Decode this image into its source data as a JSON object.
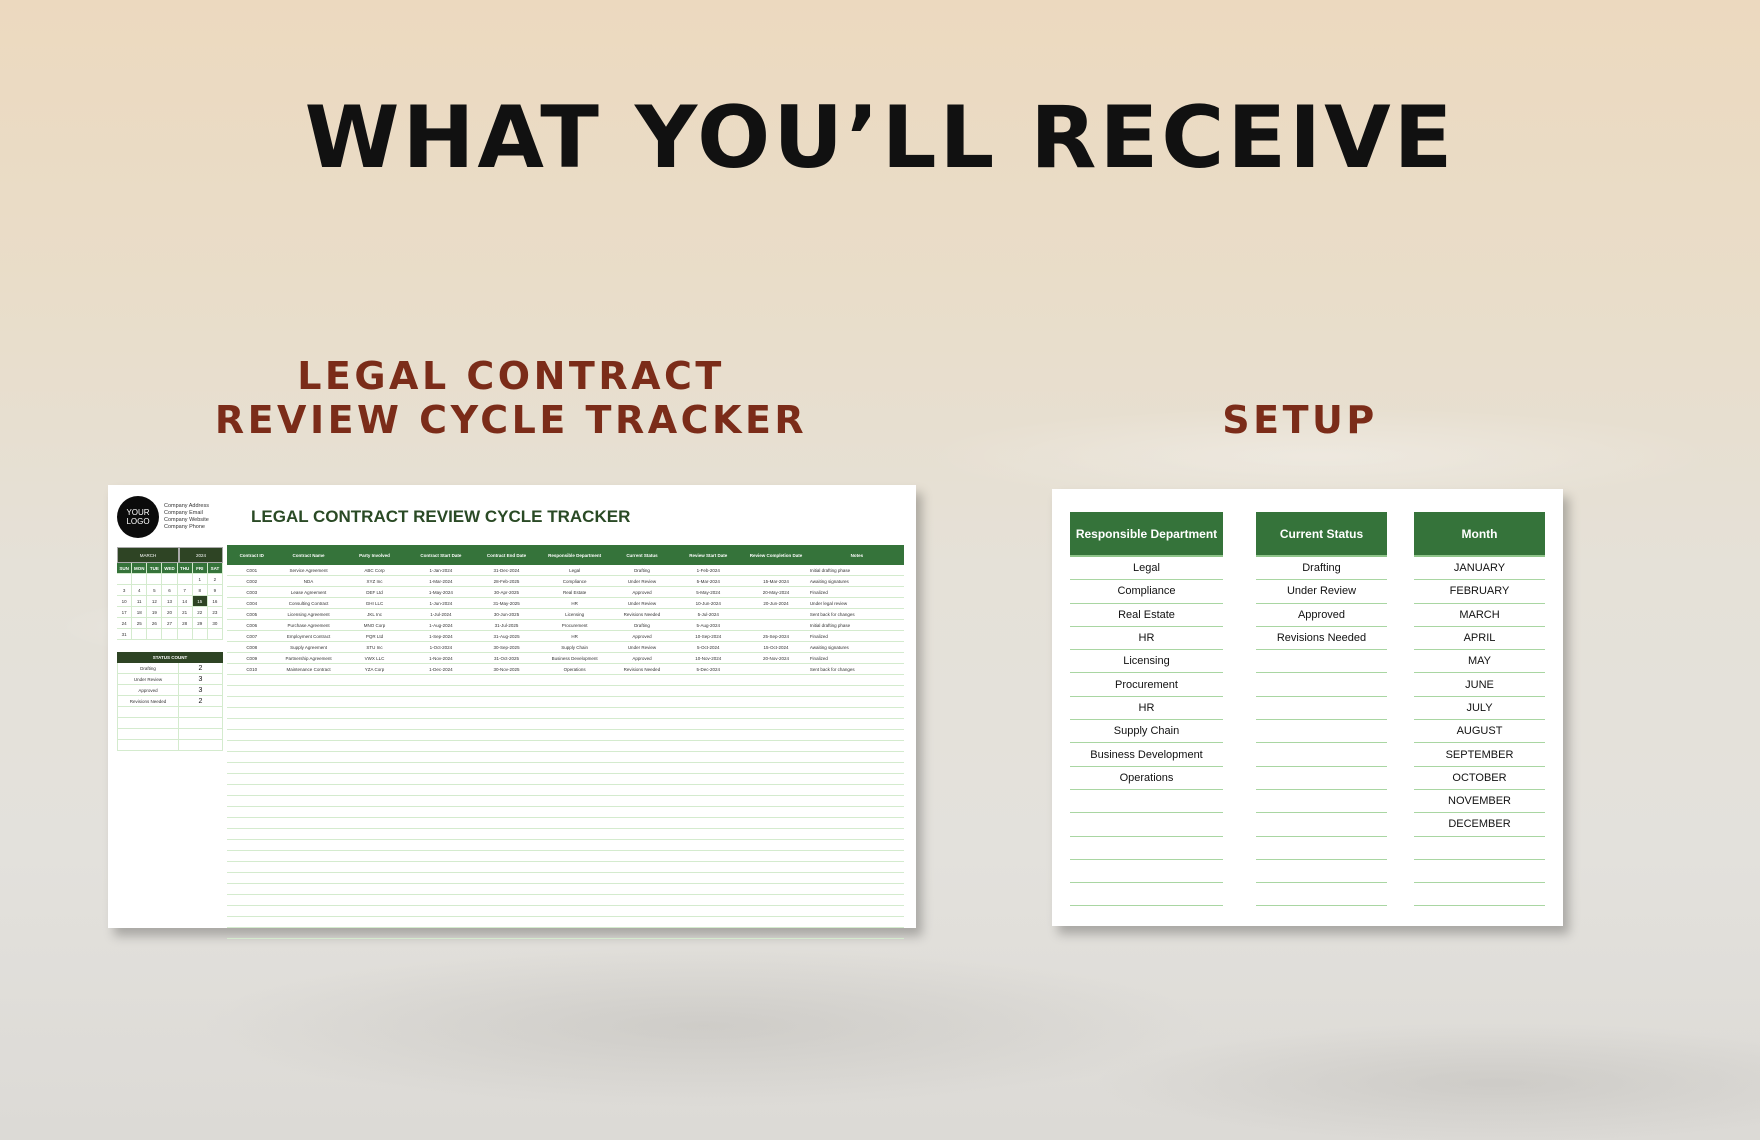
{
  "headline": "WHAT YOU’LL RECEIVE",
  "left_section": {
    "title_line1": "LEGAL CONTRACT",
    "title_line2": "REVIEW CYCLE TRACKER"
  },
  "right_section": {
    "title": "SETUP"
  },
  "colors": {
    "header_green": "#35733a",
    "dark_green": "#2e4424",
    "accent_brown": "#7b2c19",
    "row_line": "#a9d6a2"
  },
  "tracker": {
    "logo_line1": "YOUR",
    "logo_line2": "LOGO",
    "company_info": [
      "Company Address",
      "Company Email",
      "Company Website",
      "Company Phone"
    ],
    "title": "LEGAL CONTRACT REVIEW CYCLE TRACKER",
    "calendar": {
      "month": "MARCH",
      "year": "2024",
      "days_of_week": [
        "SUN",
        "MON",
        "TUE",
        "WED",
        "THU",
        "FRI",
        "SAT"
      ],
      "weeks": [
        [
          "",
          "",
          "",
          "",
          "",
          "1",
          "2"
        ],
        [
          "3",
          "4",
          "5",
          "6",
          "7",
          "8",
          "9"
        ],
        [
          "10",
          "11",
          "12",
          "13",
          "14",
          "15",
          "16"
        ],
        [
          "17",
          "18",
          "19",
          "20",
          "21",
          "22",
          "23"
        ],
        [
          "24",
          "25",
          "26",
          "27",
          "28",
          "29",
          "30"
        ],
        [
          "31",
          "",
          "",
          "",
          "",
          "",
          ""
        ]
      ],
      "selected_day": "15"
    },
    "status_count": {
      "title": "STATUS COUNT",
      "rows": [
        [
          "Drafting",
          "2"
        ],
        [
          "Under Review",
          "3"
        ],
        [
          "Approved",
          "3"
        ],
        [
          "Revisions Needed",
          "2"
        ]
      ]
    },
    "columns": [
      "Contract ID",
      "Contract Name",
      "Party Involved",
      "Contract Start Date",
      "Contract End Date",
      "Responsible Department",
      "Current Status",
      "Review Start Date",
      "Review Completion Date",
      "Notes"
    ],
    "rows": [
      [
        "C001",
        "Service Agreement",
        "ABC Corp",
        "1-Jan-2024",
        "31-Dec-2024",
        "Legal",
        "Drafting",
        "1-Feb-2024",
        "",
        "Initial drafting phase"
      ],
      [
        "C002",
        "NDA",
        "XYZ Inc",
        "1-Mar-2024",
        "28-Feb-2025",
        "Compliance",
        "Under Review",
        "5-Mar-2024",
        "15-Mar-2024",
        "Awaiting signatures"
      ],
      [
        "C003",
        "Lease Agreement",
        "DEF Ltd",
        "1-May-2024",
        "30-Apr-2025",
        "Real Estate",
        "Approved",
        "5-May-2024",
        "20-May-2024",
        "Finalized"
      ],
      [
        "C004",
        "Consulting Contract",
        "GHI LLC",
        "1-Jun-2024",
        "31-May-2025",
        "HR",
        "Under Review",
        "10-Jun-2024",
        "20-Jun-2024",
        "Under legal review"
      ],
      [
        "C005",
        "Licensing Agreement",
        "JKL Inc",
        "1-Jul-2024",
        "30-Jun-2025",
        "Licensing",
        "Revisions Needed",
        "5-Jul-2024",
        "",
        "Sent back for changes"
      ],
      [
        "C006",
        "Purchase Agreement",
        "MNO Corp",
        "1-Aug-2024",
        "31-Jul-2025",
        "Procurement",
        "Drafting",
        "5-Aug-2024",
        "",
        "Initial drafting phase"
      ],
      [
        "C007",
        "Employment Contract",
        "PQR Ltd",
        "1-Sep-2024",
        "31-Aug-2025",
        "HR",
        "Approved",
        "10-Sep-2024",
        "25-Sep-2024",
        "Finalized"
      ],
      [
        "C008",
        "Supply Agreement",
        "STU Inc",
        "1-Oct-2024",
        "30-Sep-2025",
        "Supply Chain",
        "Under Review",
        "5-Oct-2024",
        "15-Oct-2024",
        "Awaiting signatures"
      ],
      [
        "C009",
        "Partnership Agreement",
        "VWX LLC",
        "1-Nov-2024",
        "31-Oct-2025",
        "Business Development",
        "Approved",
        "10-Nov-2024",
        "20-Nov-2024",
        "Finalized"
      ],
      [
        "C010",
        "Maintenance Contract",
        "YZA Corp",
        "1-Dec-2024",
        "30-Nov-2025",
        "Operations",
        "Revisions Needed",
        "5-Dec-2024",
        "",
        "Sent back for changes"
      ]
    ]
  },
  "setup": {
    "columns": [
      {
        "header": "Responsible Department",
        "items": [
          "Legal",
          "Compliance",
          "Real Estate",
          "HR",
          "Licensing",
          "Procurement",
          "HR",
          "Supply Chain",
          "Business Development",
          "Operations"
        ]
      },
      {
        "header": "Current Status",
        "items": [
          "Drafting",
          "Under Review",
          "Approved",
          "Revisions Needed"
        ]
      },
      {
        "header": "Month",
        "items": [
          "JANUARY",
          "FEBRUARY",
          "MARCH",
          "APRIL",
          "MAY",
          "JUNE",
          "JULY",
          "AUGUST",
          "SEPTEMBER",
          "OCTOBER",
          "NOVEMBER",
          "DECEMBER"
        ]
      }
    ]
  }
}
